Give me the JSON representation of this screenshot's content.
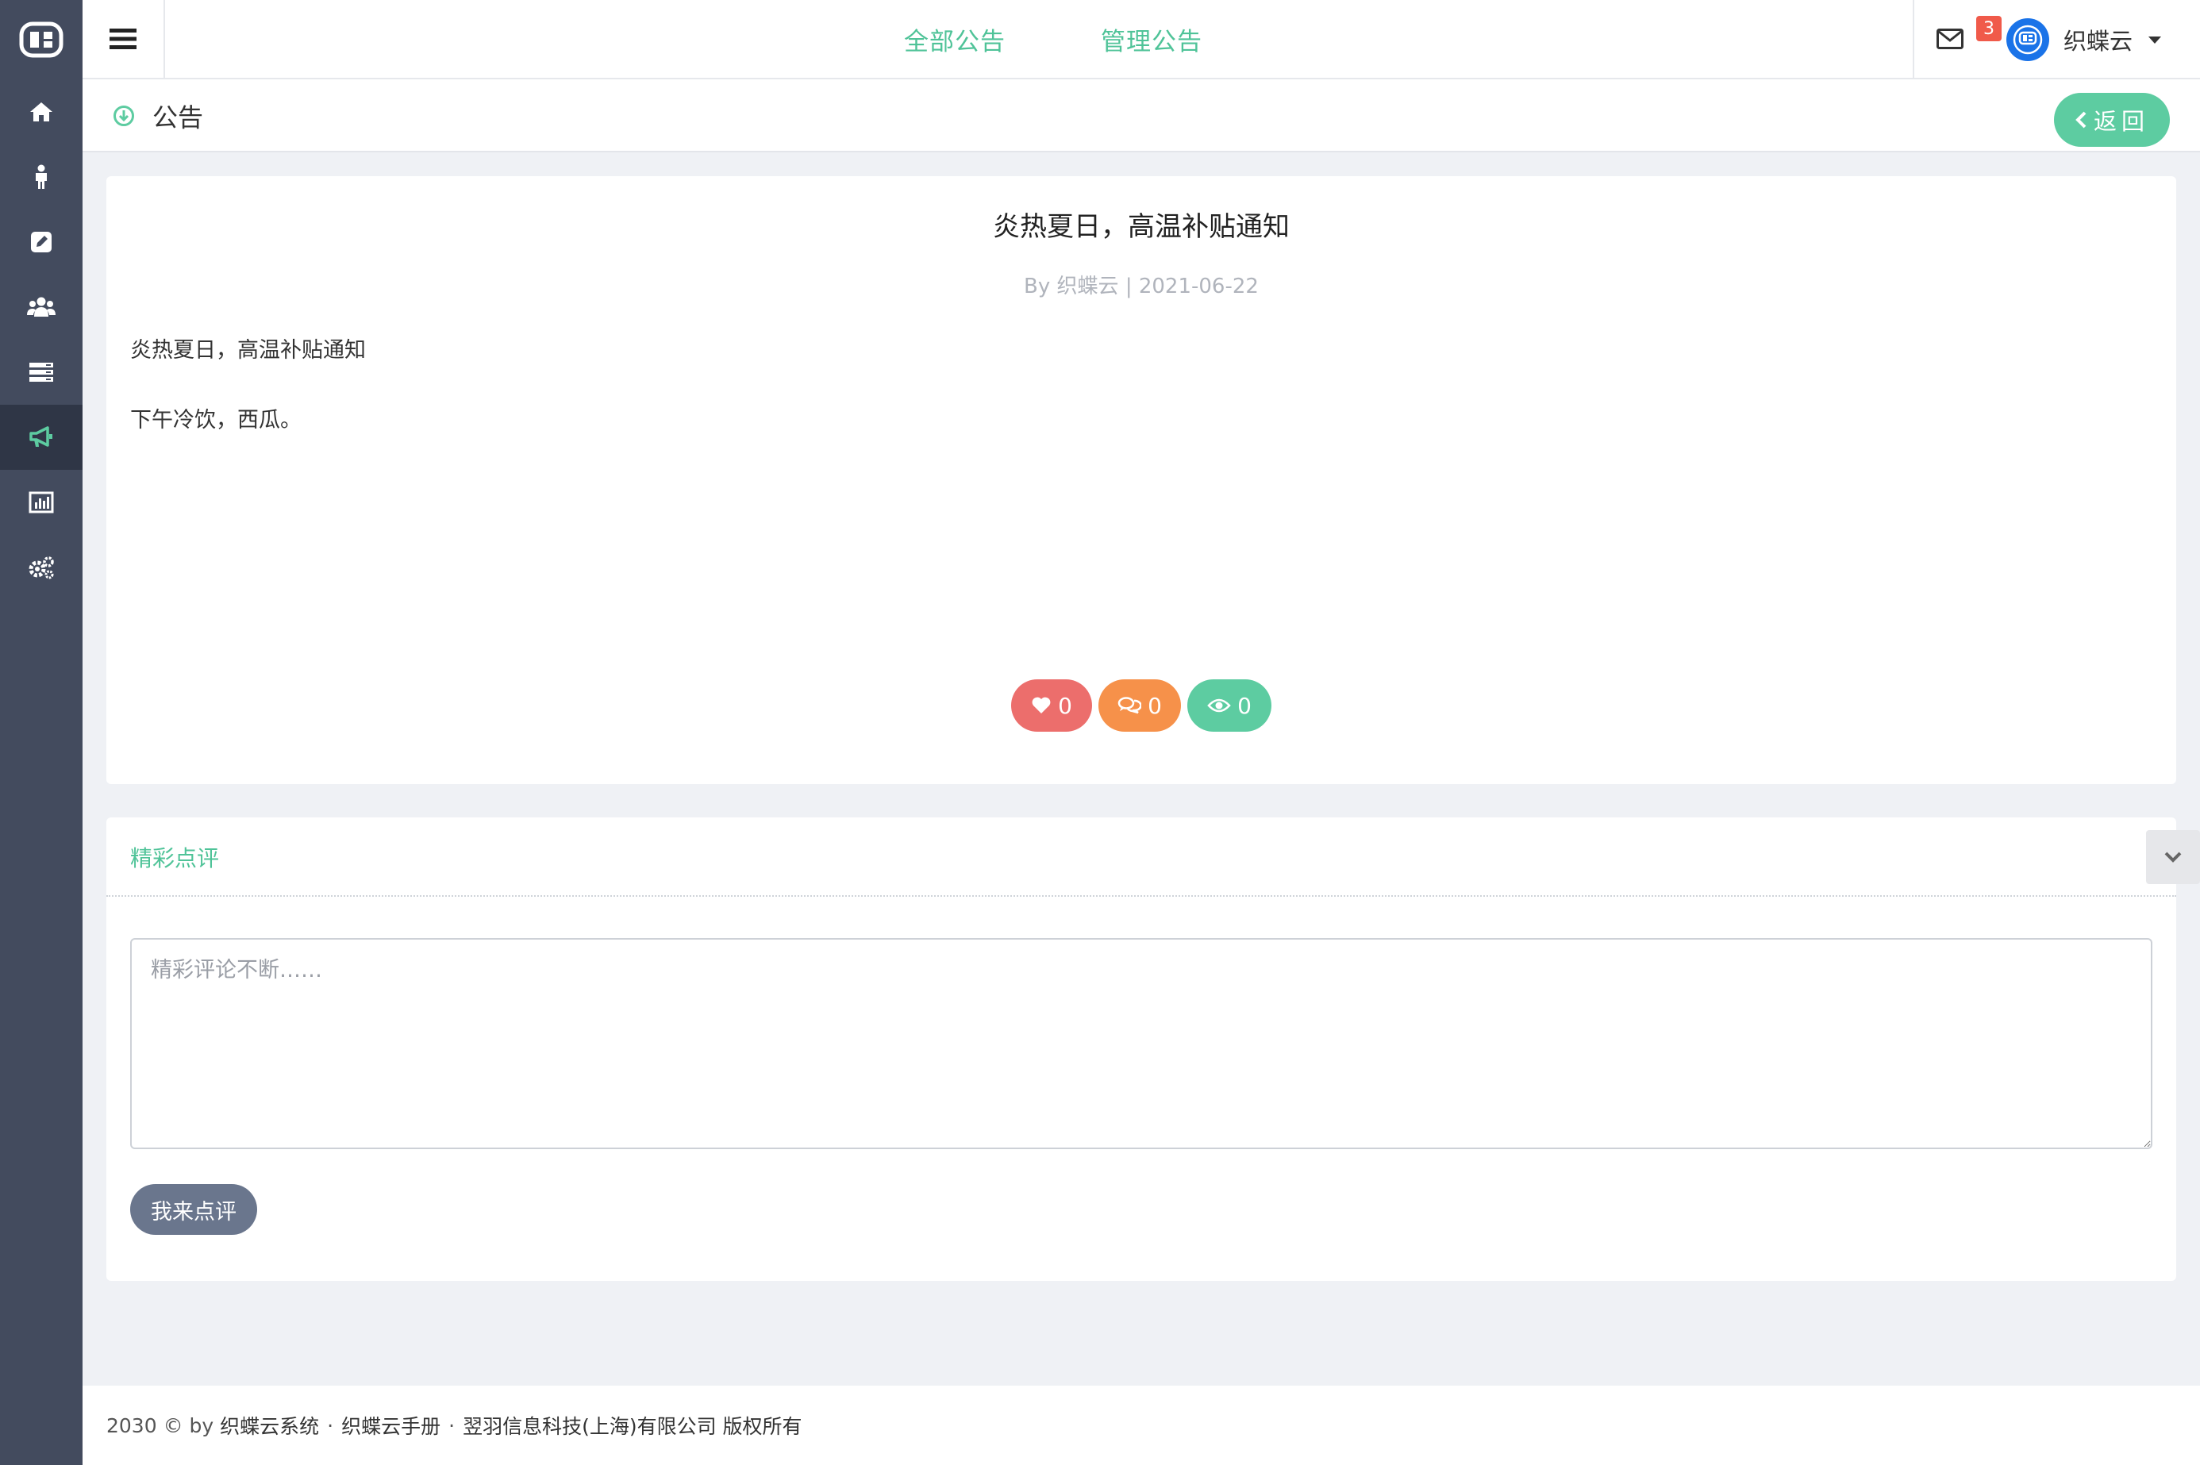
{
  "header": {
    "tabs": [
      {
        "label": "全部公告"
      },
      {
        "label": "管理公告"
      }
    ],
    "mail_badge": "3",
    "user_name": "织蝶云"
  },
  "breadcrumb": {
    "title": "公告",
    "back_label": "返回"
  },
  "article": {
    "title": "炎热夏日，高温补贴通知",
    "meta_prefix": "By",
    "author": "织蝶云",
    "date": "2021-06-22",
    "paragraphs": [
      "炎热夏日，高温补贴通知",
      "下午冷饮，西瓜。"
    ],
    "likes": "0",
    "comments": "0",
    "views": "0"
  },
  "comments": {
    "section_title": "精彩点评",
    "placeholder": "精彩评论不断……",
    "submit_label": "我来点评"
  },
  "footer": {
    "copyright": "2030 © by",
    "system_link": "织蝶云系统",
    "manual_link": "织蝶云手册",
    "company": "翌羽信息科技(上海)有限公司 版权所有"
  },
  "colors": {
    "sidebar": "#434b5e",
    "accent": "#5dcca1",
    "like": "#ec6e6c",
    "comment": "#f6914a",
    "badge": "#f05a4a"
  },
  "icons": {
    "sidebar": [
      "logo-icon",
      "home-icon",
      "person-icon",
      "edit-icon",
      "group-icon",
      "list-icon",
      "megaphone-icon",
      "chart-icon",
      "gears-icon"
    ]
  }
}
